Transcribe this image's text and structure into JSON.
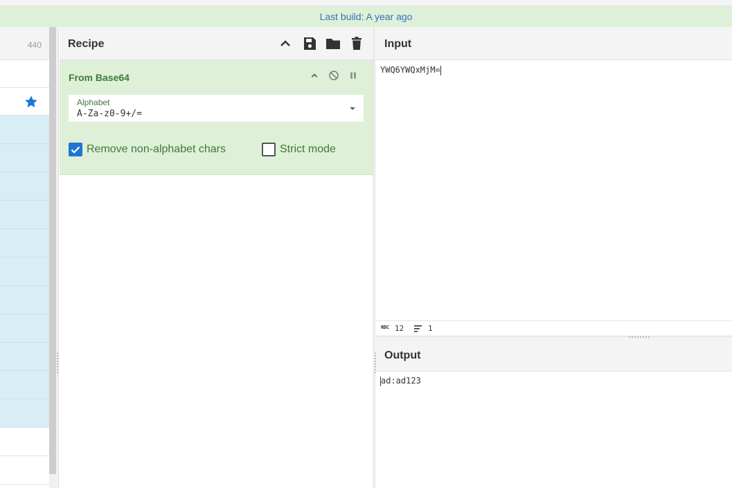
{
  "banner": {
    "text": "Last build: A year ago"
  },
  "operations": {
    "count": "440"
  },
  "recipe": {
    "title": "Recipe",
    "operation": {
      "name": "From Base64",
      "alphabet_label": "Alphabet",
      "alphabet_value": "A-Za-z0-9+/=",
      "remove_non_alphabet_label": "Remove non-alphabet chars",
      "remove_non_alphabet_checked": true,
      "strict_mode_label": "Strict mode",
      "strict_mode_checked": false
    }
  },
  "input": {
    "title": "Input",
    "text": "YWQ6YWQxMjM=",
    "length_label": "RBC",
    "length": "12",
    "lines": "1"
  },
  "output": {
    "title": "Output",
    "text": "ad:ad123"
  },
  "colors": {
    "banner_bg": "#dff0d8",
    "banner_text": "#2f74c0",
    "operation_bg": "#dff0d8",
    "operation_text": "#3c7a3a",
    "checkbox_accent": "#1f76d2",
    "ops_list_bg": "#d9edf7"
  },
  "icons": {
    "favourite": "star-icon",
    "recipe_collapse": "chevron-up-icon",
    "save": "floppy-disk-icon",
    "load": "folder-icon",
    "clear": "trash-icon",
    "op_collapse": "chevron-up-icon",
    "op_disable": "disable-icon",
    "op_pause": "pause-icon",
    "lines": "lines-icon"
  }
}
